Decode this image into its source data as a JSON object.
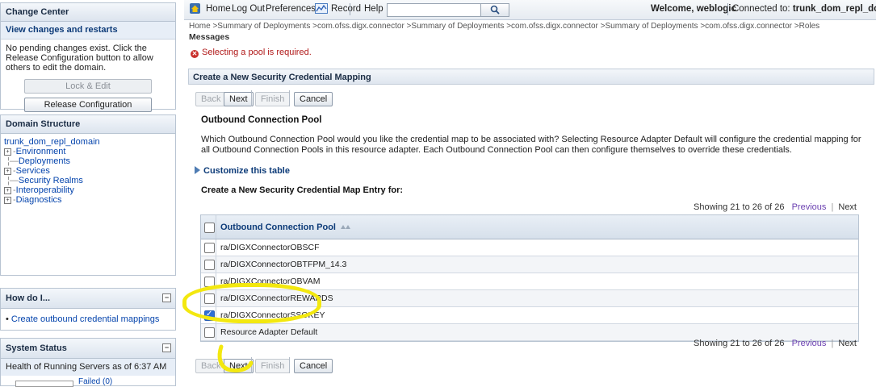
{
  "change_center": {
    "title": "Change Center",
    "view_changes": "View changes and restarts",
    "message": "No pending changes exist. Click the Release Configuration button to allow others to edit the domain.",
    "lock_edit_label": "Lock & Edit",
    "release_label": "Release Configuration"
  },
  "domain_structure": {
    "title": "Domain Structure",
    "root": "trunk_dom_repl_domain",
    "items": [
      {
        "label": "Environment",
        "expandable": true
      },
      {
        "label": "Deployments",
        "expandable": false
      },
      {
        "label": "Services",
        "expandable": true
      },
      {
        "label": "Security Realms",
        "expandable": false
      },
      {
        "label": "Interoperability",
        "expandable": true
      },
      {
        "label": "Diagnostics",
        "expandable": true
      }
    ]
  },
  "how_do_i": {
    "title": "How do I...",
    "items": [
      "Create outbound credential mappings"
    ]
  },
  "system_status": {
    "title": "System Status",
    "health": "Health of Running Servers as of  6:37 AM",
    "failed": "Failed (0)"
  },
  "topbar": {
    "home": "Home",
    "logout": "Log Out",
    "preferences": "Preferences",
    "record": "Record",
    "help": "Help",
    "search_value": "",
    "welcome_prefix": "Welcome,",
    "user": "weblogic",
    "connected_prefix": "Connected to:",
    "domain": "trunk_dom_repl_domain"
  },
  "breadcrumb": "Home >Summary of Deployments >com.ofss.digx.connector >Summary of Deployments >com.ofss.digx.connector >Summary of Deployments >com.ofss.digx.connector >Roles",
  "messages": {
    "title": "Messages",
    "error": "Selecting a pool is required."
  },
  "wizard": {
    "title": "Create a New Security Credential Mapping",
    "back": "Back",
    "next": "Next",
    "finish": "Finish",
    "cancel": "Cancel",
    "section_heading": "Outbound Connection Pool",
    "description": "Which Outbound Connection Pool would you like the credential map to be associated with? Selecting Resource Adapter Default will configure the credential mapping for all Outbound Connection Pools in this resource adapter. Each Outbound Connection Pool can then configure themselves to override these credentials.",
    "customize": "Customize this table",
    "entry_heading": "Create a New Security Credential Map Entry for:",
    "pager_text": "Showing 21 to 26 of 26",
    "previous": "Previous",
    "next_page": "Next",
    "column_header": "Outbound Connection Pool",
    "rows": [
      {
        "name": "ra/DIGXConnectorOBSCF",
        "checked": false
      },
      {
        "name": "ra/DIGXConnectorOBTFPM_14.3",
        "checked": false
      },
      {
        "name": "ra/DIGXConnectorOBVAM",
        "checked": false
      },
      {
        "name": "ra/DIGXConnectorREWARDS",
        "checked": false
      },
      {
        "name": "ra/DIGXConnectorSSOKEY",
        "checked": true
      },
      {
        "name": "Resource Adapter Default",
        "checked": false
      }
    ]
  },
  "colors": {
    "highlight": "#f3e80f",
    "error": "#b01818",
    "link": "#0645ad"
  }
}
